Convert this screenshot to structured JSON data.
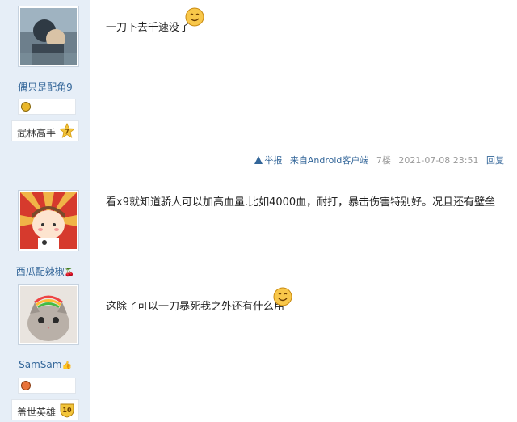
{
  "post1": {
    "author": {
      "name": "偶只是配角9",
      "rank": "武林高手",
      "level": "7"
    },
    "content": "一刀下去千速没了",
    "meta": {
      "report": "举报",
      "client": "来自Android客户端",
      "floor": "7楼",
      "time": "2021-07-08 23:51",
      "reply": "回复"
    }
  },
  "post2": {
    "authors": [
      {
        "name": "西瓜配辣椒",
        "suffix_icon": "cherry-icon"
      },
      {
        "name": "SamSam",
        "suffix_icon": "thumb-icon",
        "rank": "盖世英雄",
        "level": "10"
      }
    ],
    "content1": "看x9就知道骄人可以加高血量.比如4000血，耐打，暴击伤害特别好。况且还有壁垒",
    "content2": "这除了可以一刀暴死我之外还有什么用"
  },
  "colors": {
    "sidebar": "#e6eef7",
    "link": "#336699",
    "level_badge": "#f3c53b"
  }
}
